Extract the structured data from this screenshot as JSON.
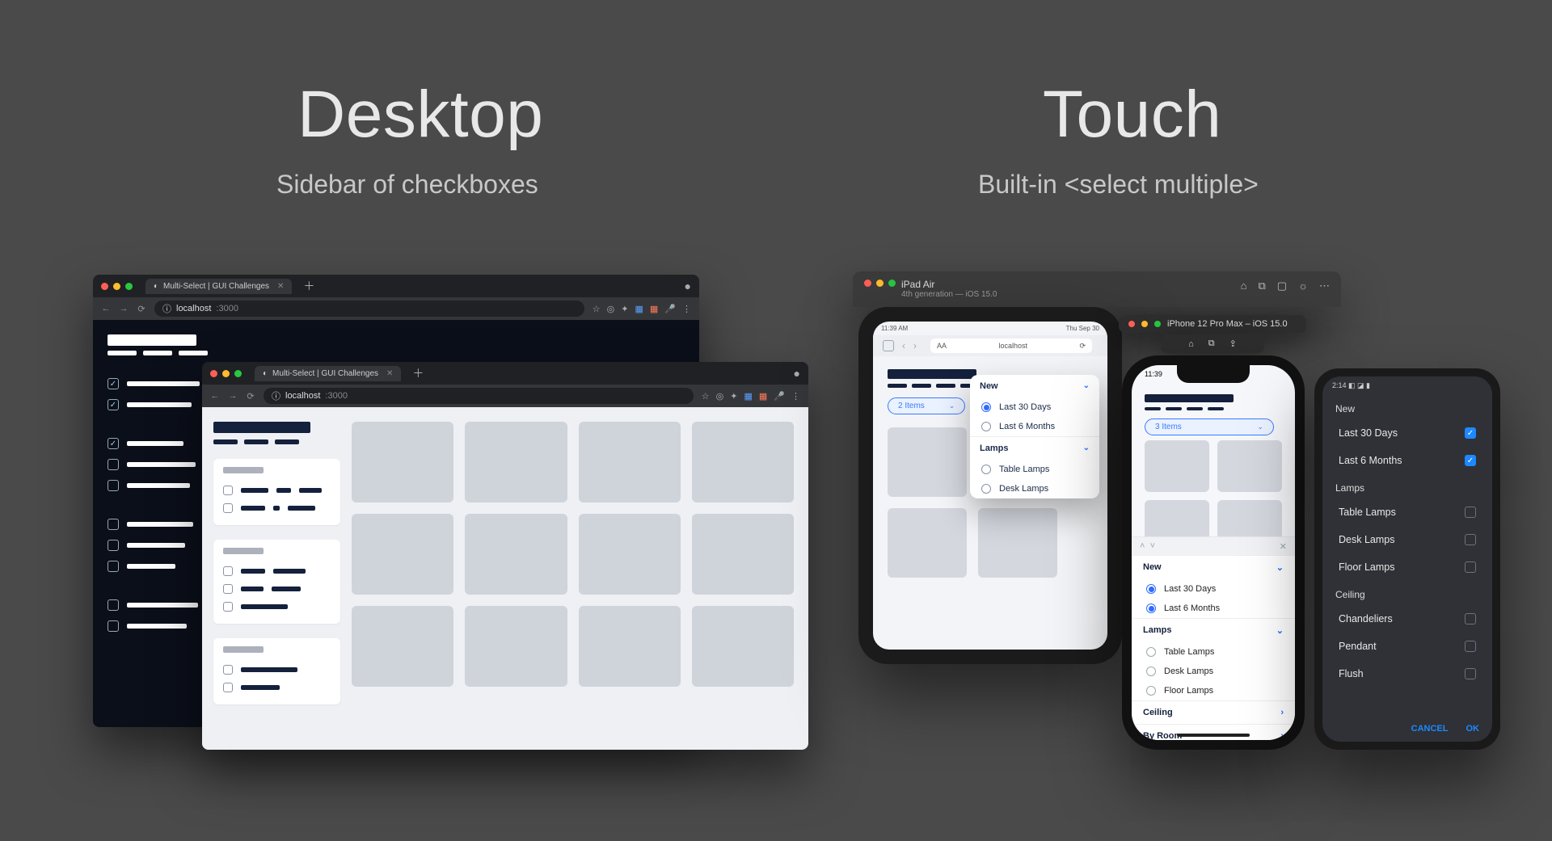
{
  "left": {
    "title": "Desktop",
    "subtitle": "Sidebar of checkboxes"
  },
  "right": {
    "title": "Touch",
    "subtitle": "Built-in <select multiple>"
  },
  "browser": {
    "tab_title": "Multi-Select | GUI Challenges",
    "url_host": "localhost",
    "url_port": ":3000"
  },
  "ipad": {
    "sim_name": "iPad Air",
    "sim_detail": "4th generation — iOS 15.0",
    "status_left": "11:39 AM",
    "status_right": "Thu Sep 30",
    "addr_label": "AA",
    "addr_center": "localhost",
    "pill_label": "2 Items",
    "popover": {
      "sec1": "New",
      "opt1": "Last 30 Days",
      "opt2": "Last 6 Months",
      "sec2": "Lamps",
      "opt3": "Table Lamps",
      "opt4": "Desk Lamps"
    }
  },
  "iphone": {
    "sim_name": "iPhone 12 Pro Max – iOS 15.0",
    "time": "11:39",
    "pill_label": "3 Items",
    "sheet": {
      "sec1": "New",
      "opt1": "Last 30 Days",
      "opt2": "Last 6 Months",
      "sec2": "Lamps",
      "opt3": "Table Lamps",
      "opt4": "Desk Lamps",
      "opt5": "Floor Lamps",
      "sec3": "Ceiling",
      "sec4": "By Room"
    }
  },
  "android": {
    "time": "2:14",
    "sec1": "New",
    "opt1": "Last 30 Days",
    "opt2": "Last 6 Months",
    "sec2": "Lamps",
    "opt3": "Table Lamps",
    "opt4": "Desk Lamps",
    "opt5": "Floor Lamps",
    "sec3": "Ceiling",
    "opt6": "Chandeliers",
    "opt7": "Pendant",
    "opt8": "Flush",
    "cancel": "CANCEL",
    "ok": "OK"
  }
}
